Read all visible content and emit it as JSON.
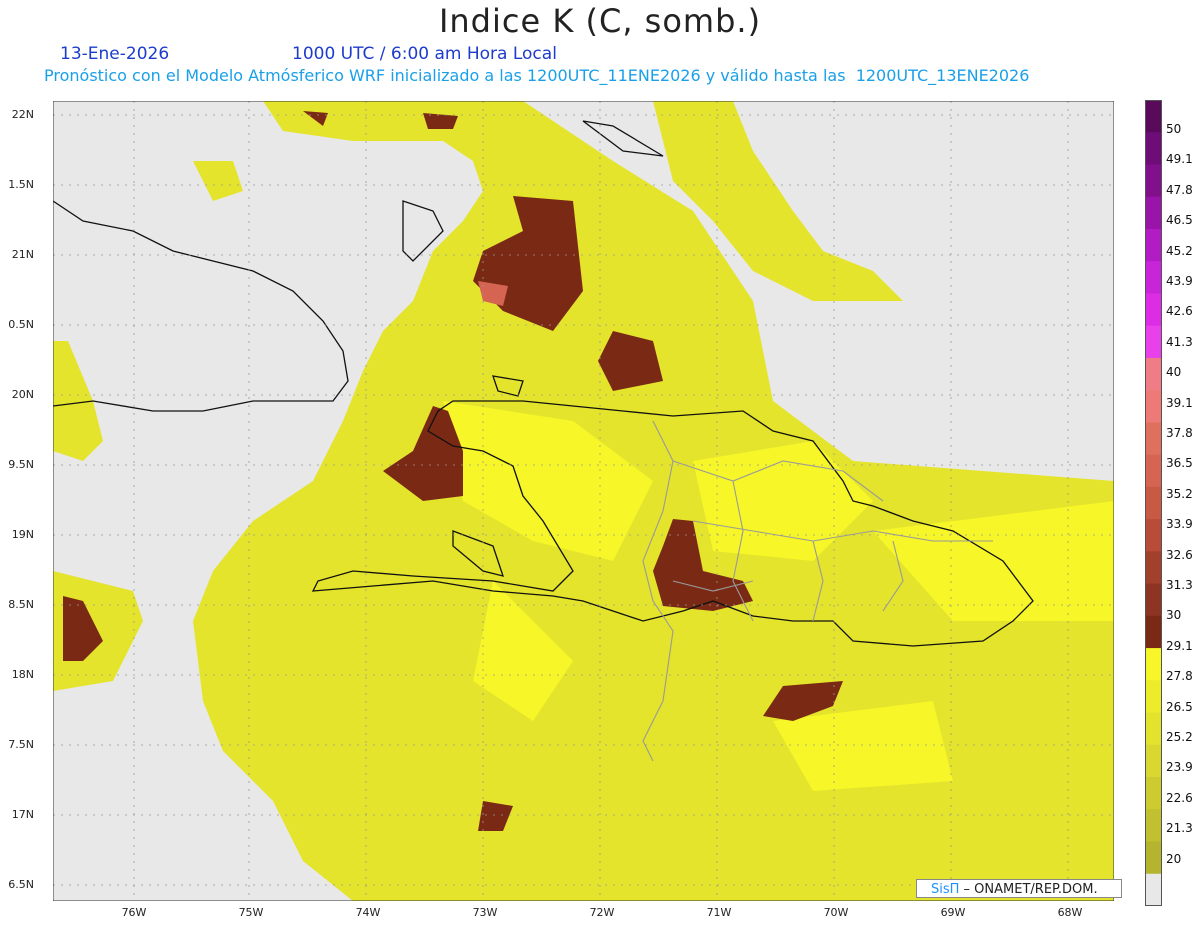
{
  "header": {
    "title": "Indice K (C, somb.)",
    "date": "13-Ene-2026",
    "time": "1000 UTC / 6:00 am Hora Local",
    "subtitle": "Pronóstico con el Modelo Atmósferico WRF inicializado a las 1200UTC_11ENE2026 y válido hasta las  1200UTC_13ENE2026"
  },
  "axes": {
    "lat_labels": [
      "22N",
      "1.5N",
      "21N",
      "0.5N",
      "20N",
      "9.5N",
      "19N",
      "8.5N",
      "18N",
      "7.5N",
      "17N",
      "6.5N"
    ],
    "lon_labels": [
      "76W",
      "75W",
      "74W",
      "73W",
      "72W",
      "71W",
      "70W",
      "69W",
      "68W"
    ]
  },
  "colorbar": {
    "labels": [
      "50",
      "49.1",
      "47.8",
      "46.5",
      "45.2",
      "43.9",
      "42.6",
      "41.3",
      "40",
      "39.1",
      "37.8",
      "36.5",
      "35.2",
      "33.9",
      "32.6",
      "31.3",
      "30",
      "29.1",
      "27.8",
      "26.5",
      "25.2",
      "23.9",
      "22.6",
      "21.3",
      "20"
    ],
    "colors": [
      "#5a0a5a",
      "#6e0d78",
      "#820f8c",
      "#9a14aa",
      "#b21cc4",
      "#c824d8",
      "#dc2ce6",
      "#e840ea",
      "#f07c86",
      "#ee7a78",
      "#e0705e",
      "#d66452",
      "#c85a44",
      "#b84c38",
      "#a3402c",
      "#8e3422",
      "#7a2a14",
      "#f6f628",
      "#ecec2a",
      "#e3e32e",
      "#d8d830",
      "#cccc30",
      "#c0c030",
      "#b4b42e",
      "#e8e8e8"
    ]
  },
  "credit": {
    "brand": "SisΠ",
    "text": " – ONAMET/REP.DOM."
  }
}
